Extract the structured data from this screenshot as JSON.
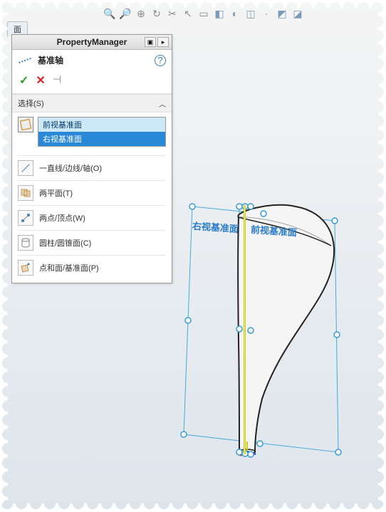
{
  "tab_label": "面",
  "toolbar_icons": [
    "search-icon",
    "cat-icon",
    "magnify-icon",
    "rotate-icon",
    "cut-icon",
    "cursor-icon",
    "sheet-icon",
    "cube1-icon",
    "cube2-icon",
    "cube3-icon",
    "separator",
    "cube4-icon",
    "cube5-icon"
  ],
  "property_manager": {
    "title": "PropertyManager",
    "feature_name": "基准轴",
    "sections": {
      "selection": {
        "header": "选择(S)",
        "items": [
          "前视基准面",
          "右视基准面"
        ],
        "options": [
          {
            "id": "line-edge-axis",
            "label": "一直线/边线/轴(O)",
            "icon": "line"
          },
          {
            "id": "two-planes",
            "label": "两平面(T)",
            "icon": "planes"
          },
          {
            "id": "two-points",
            "label": "两点/顶点(W)",
            "icon": "points"
          },
          {
            "id": "cylinder-cone",
            "label": "圆柱/圆锥面(C)",
            "icon": "cylinder"
          },
          {
            "id": "point-plane",
            "label": "点和面/基准面(P)",
            "icon": "pointplane"
          }
        ]
      }
    }
  },
  "viewport_labels": {
    "right_plane": "右视基准面",
    "front_plane": "前视基准面"
  }
}
